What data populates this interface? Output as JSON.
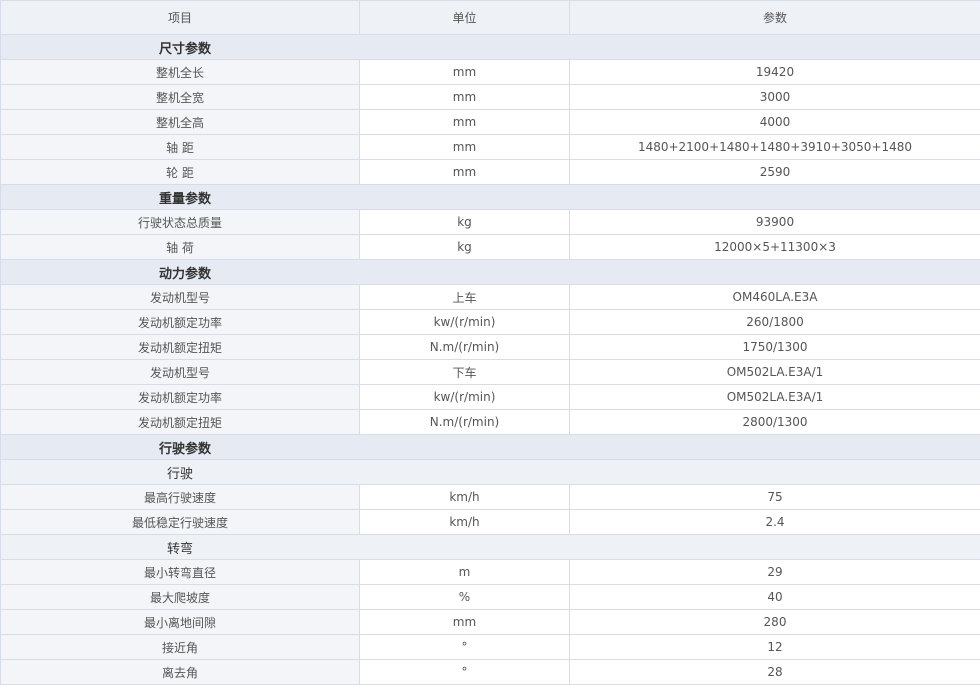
{
  "header": {
    "col_item": "项目",
    "col_unit": "单位",
    "col_value": "参数"
  },
  "rows": [
    {
      "type": "section",
      "label": "尺寸参数"
    },
    {
      "type": "row",
      "label": "整机全长",
      "unit": "mm",
      "value": "19420"
    },
    {
      "type": "row",
      "label": "整机全宽",
      "unit": "mm",
      "value": "3000"
    },
    {
      "type": "row",
      "label": "整机全高",
      "unit": "mm",
      "value": "4000"
    },
    {
      "type": "row",
      "label": "轴 距",
      "unit": "mm",
      "value": "1480+2100+1480+1480+3910+3050+1480"
    },
    {
      "type": "row",
      "label": "轮 距",
      "unit": "mm",
      "value": "2590"
    },
    {
      "type": "section",
      "label": "重量参数"
    },
    {
      "type": "row",
      "label": "行驶状态总质量",
      "unit": "kg",
      "value": "93900"
    },
    {
      "type": "row",
      "label": "轴 荷",
      "unit": "kg",
      "value": "12000×5+11300×3"
    },
    {
      "type": "section",
      "label": "动力参数"
    },
    {
      "type": "row",
      "label": "发动机型号",
      "unit": "上车",
      "value": "OM460LA.E3A"
    },
    {
      "type": "row",
      "label": "发动机额定功率",
      "unit": "kw/(r/min)",
      "value": "260/1800"
    },
    {
      "type": "row",
      "label": "发动机额定扭矩",
      "unit": "N.m/(r/min)",
      "value": "1750/1300"
    },
    {
      "type": "row",
      "label": "发动机型号",
      "unit": "下车",
      "value": "OM502LA.E3A/1"
    },
    {
      "type": "row",
      "label": "发动机额定功率",
      "unit": "kw/(r/min)",
      "value": "OM502LA.E3A/1"
    },
    {
      "type": "row",
      "label": "发动机额定扭矩",
      "unit": "N.m/(r/min)",
      "value": "2800/1300"
    },
    {
      "type": "section",
      "label": "行驶参数"
    },
    {
      "type": "subsection",
      "label": "行驶"
    },
    {
      "type": "row",
      "label": "最高行驶速度",
      "unit": "km/h",
      "value": "75"
    },
    {
      "type": "row",
      "label": "最低稳定行驶速度",
      "unit": "km/h",
      "value": "2.4"
    },
    {
      "type": "subsection",
      "label": "转弯"
    },
    {
      "type": "row",
      "label": "最小转弯直径",
      "unit": "m",
      "value": "29"
    },
    {
      "type": "row",
      "label": "最大爬坡度",
      "unit": "%",
      "value": "40"
    },
    {
      "type": "row",
      "label": "最小离地间隙",
      "unit": "mm",
      "value": "280"
    },
    {
      "type": "row",
      "label": "接近角",
      "unit": "°",
      "value": "12"
    },
    {
      "type": "row",
      "label": "离去角",
      "unit": "°",
      "value": "28"
    }
  ]
}
